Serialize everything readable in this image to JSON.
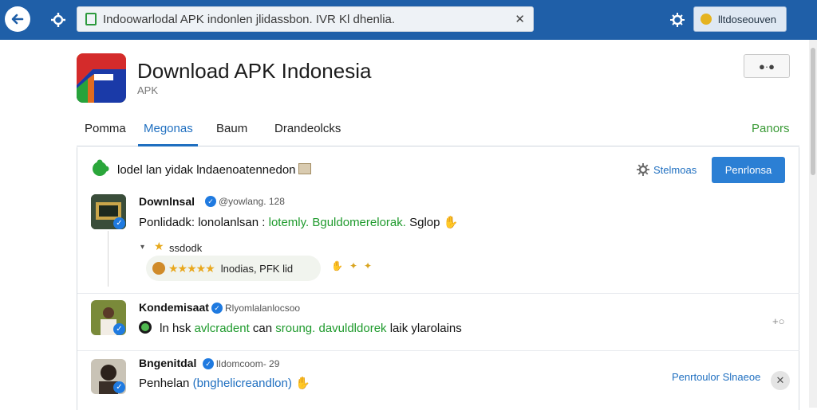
{
  "browser": {
    "address_text": "Indoowarlodal APK indonlen jlidassbon. IVR Kl dhenlia.",
    "account_label": "lltdoseouven",
    "close_glyph": "✕"
  },
  "app": {
    "title": "Download APK Indonesia",
    "subtitle": "APK",
    "icon_colors": [
      "#d42b2b",
      "#f2c319",
      "#1a3aa8",
      "#27a33b"
    ]
  },
  "tabs": [
    {
      "label": "Pomma",
      "active": false
    },
    {
      "label": "Megonas",
      "active": true
    },
    {
      "label": "Baum",
      "active": false
    },
    {
      "label": "Drandeolcks",
      "active": false
    },
    {
      "label": "Panors",
      "active": false
    }
  ],
  "compose": {
    "prompt": "lodel lan yidak lndaenoatennedon",
    "settings_label": "Stelmoas",
    "primary_button": "Penrlonsa"
  },
  "posts": [
    {
      "name": "Downlnsal",
      "meta": "@yowlang. 128",
      "text_plain": "Ponlidadk: lonolanlsan :",
      "text_green": "lotemly. Bguldomerelorak.",
      "text_tail": "Sglop",
      "reply_label": "ssdodk",
      "pill_text": "lnodias, PFK lid",
      "pill_tail": "",
      "rating_stars": 5
    },
    {
      "name": "Kondemisaat",
      "meta": "Rlyomlalanlocsoo",
      "text_plain": "ln hsk",
      "text_green": "avlcradent",
      "text_mid": "can",
      "text_green2": "sroung. davuldldorek",
      "text_tail": "laik ylarolains"
    },
    {
      "name": "Bngenitdal",
      "meta": "lIdomcoom- 29",
      "text_plain": "Penhelan",
      "text_blue": "(bnghelicreandlon)",
      "side_link": "Penrtoulor Slnaeoe"
    }
  ],
  "accent_colors": {
    "topbar": "#1f5fa8",
    "primary": "#2b7fd4",
    "link": "#1f6fc0",
    "green": "#1e9a2c"
  }
}
